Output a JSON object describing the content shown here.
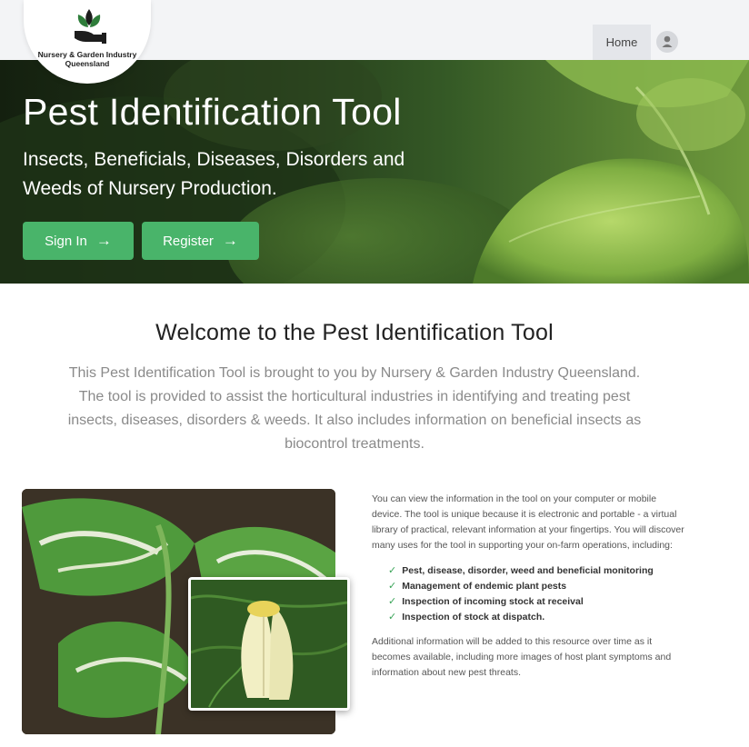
{
  "header": {
    "logo_text_line1": "Nursery & Garden Industry",
    "logo_text_line2": "Queensland",
    "nav_home": "Home",
    "user_icon": "user-icon"
  },
  "hero": {
    "title": "Pest Identification Tool",
    "subtitle": "Insects, Beneficials, Diseases, Disorders and Weeds of Nursery Production.",
    "signin_label": "Sign In",
    "register_label": "Register",
    "arrow_glyph": "→"
  },
  "welcome": {
    "title": "Welcome to the Pest Identification Tool",
    "text": "This Pest Identification Tool is brought to you by Nursery & Garden Industry Queensland. The tool is provided to assist the horticultural industries in identifying and treating pest insects, diseases, disorders & weeds. It also includes information on beneficial insects as biocontrol treatments."
  },
  "info": {
    "intro": "You can view the information in the tool on your computer or mobile device. The tool is unique because it is electronic and portable - a virtual library of practical, relevant information at your fingertips. You will discover many uses for the tool in supporting your on-farm operations, including:",
    "items": [
      "Pest, disease, disorder, weed and beneficial monitoring",
      "Management of endemic plant pests",
      "Inspection of incoming stock at receival",
      "Inspection of stock at dispatch."
    ],
    "check_glyph": "✓",
    "outro": "Additional information will be added to this resource over time as it becomes available, including more images of host plant symptoms and information about new pest threats."
  },
  "colors": {
    "accent_green": "#49b46a",
    "check_green": "#3aa458",
    "header_bg": "#f3f4f6"
  }
}
